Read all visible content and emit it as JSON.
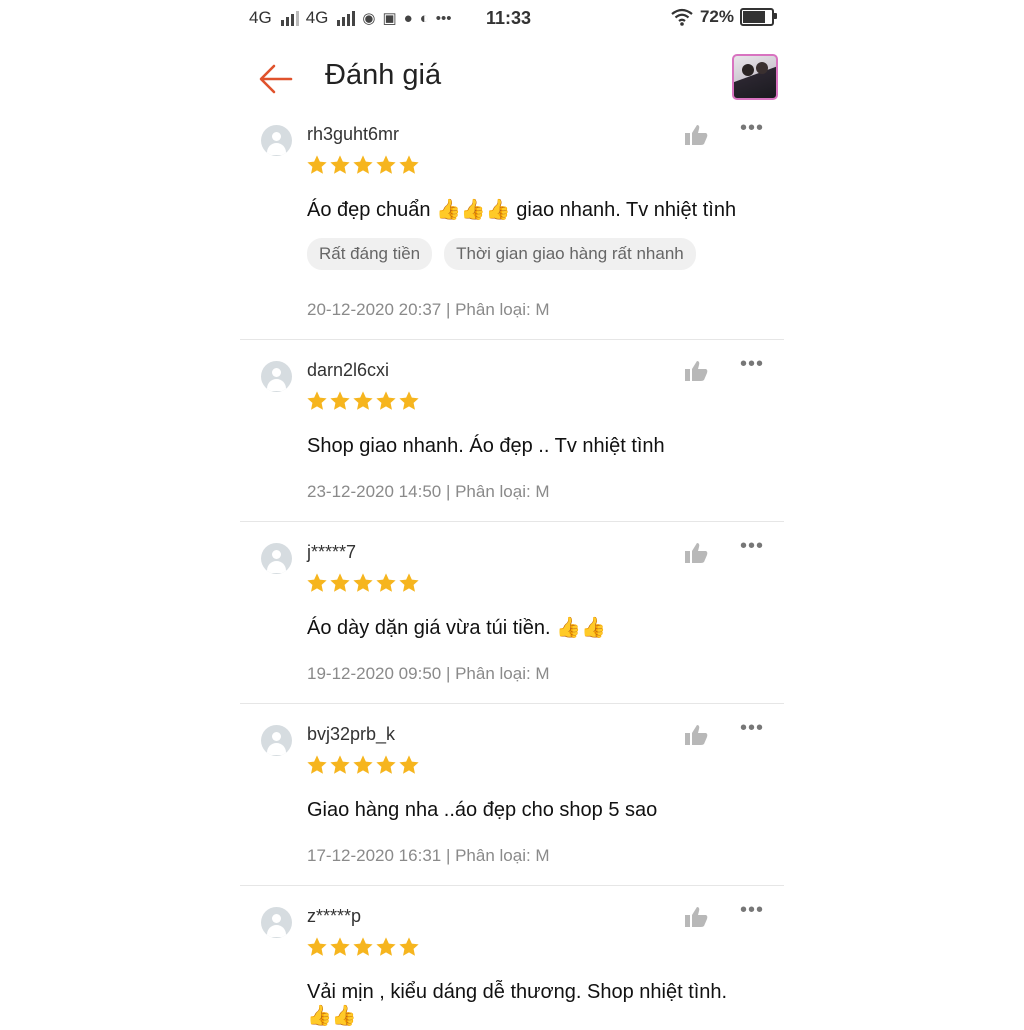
{
  "status_bar": {
    "net1": "4G",
    "net2": "4G",
    "ellipsis": "•••",
    "time": "11:33",
    "battery": "72%",
    "battery_level": 0.72
  },
  "header": {
    "title": "Đánh giá",
    "back_icon": "arrow-left-icon",
    "accent": "#e0522c"
  },
  "colors": {
    "star": "#f6b51e",
    "divider": "#e6e6e6"
  },
  "reviews": [
    {
      "user": "rh3guht6mr",
      "rating": 5,
      "text": "Áo đẹp chuẩn",
      "emoji": "👍👍👍",
      "text2": "giao nhanh. Tv nhiệt tình",
      "tags": [
        "Rất đáng tiền",
        "Thời gian giao hàng rất nhanh"
      ],
      "meta": "20-12-2020 20:37 | Phân loại: M"
    },
    {
      "user": "darn2l6cxi",
      "rating": 5,
      "text": "Shop giao nhanh. Áo đẹp .. Tv nhiệt tình",
      "meta": "23-12-2020 14:50 | Phân loại: M"
    },
    {
      "user": "j*****7",
      "rating": 5,
      "text": "Áo dày dặn giá vừa túi tiền.",
      "emoji": "👍👍",
      "meta": "19-12-2020 09:50 | Phân loại: M"
    },
    {
      "user": "bvj32prb_k",
      "rating": 5,
      "text": "Giao hàng nha ..áo đẹp cho shop 5 sao",
      "meta": "17-12-2020 16:31 | Phân loại: M"
    },
    {
      "user": "z*****p",
      "rating": 5,
      "text": "Vải mịn , kiểu dáng dễ thương. Shop nhiệt tình.",
      "emoji": "👍👍"
    }
  ]
}
